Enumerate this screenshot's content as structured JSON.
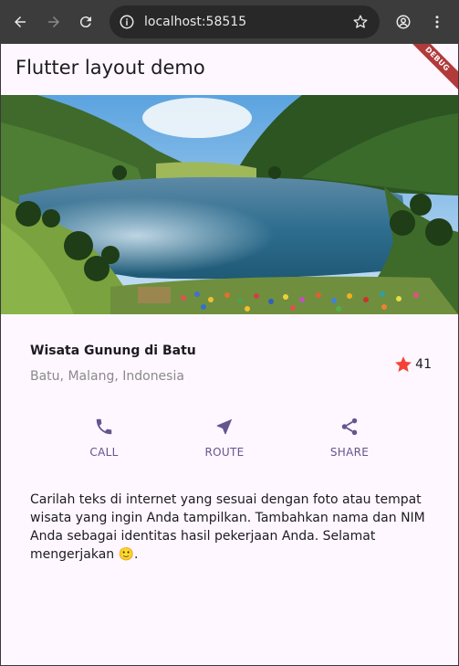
{
  "browser": {
    "url": "localhost:58515",
    "icons": {
      "back": "back-arrow-icon",
      "forward": "forward-arrow-icon",
      "reload": "reload-icon",
      "site_info": "site-info-icon",
      "bookmark": "star-icon",
      "profile": "profile-icon",
      "menu": "kebab-menu-icon"
    }
  },
  "app": {
    "title": "Flutter layout demo",
    "debug_banner": "DEBUG"
  },
  "place": {
    "name": "Wisata Gunung di Batu",
    "location": "Batu, Malang, Indonesia",
    "rating_count": "41"
  },
  "actions": [
    {
      "label": "CALL",
      "icon": "phone-icon"
    },
    {
      "label": "ROUTE",
      "icon": "navigation-icon"
    },
    {
      "label": "SHARE",
      "icon": "share-icon"
    }
  ],
  "description": "Carilah teks di internet yang sesuai dengan foto atau tempat wisata yang ingin Anda tampilkan. Tambahkan nama dan NIM Anda sebagai identitas hasil pekerjaan Anda. Selamat mengerjakan 🙂.",
  "colors": {
    "accent": "#65558f",
    "star": "#f44336",
    "background": "#fef7ff"
  }
}
